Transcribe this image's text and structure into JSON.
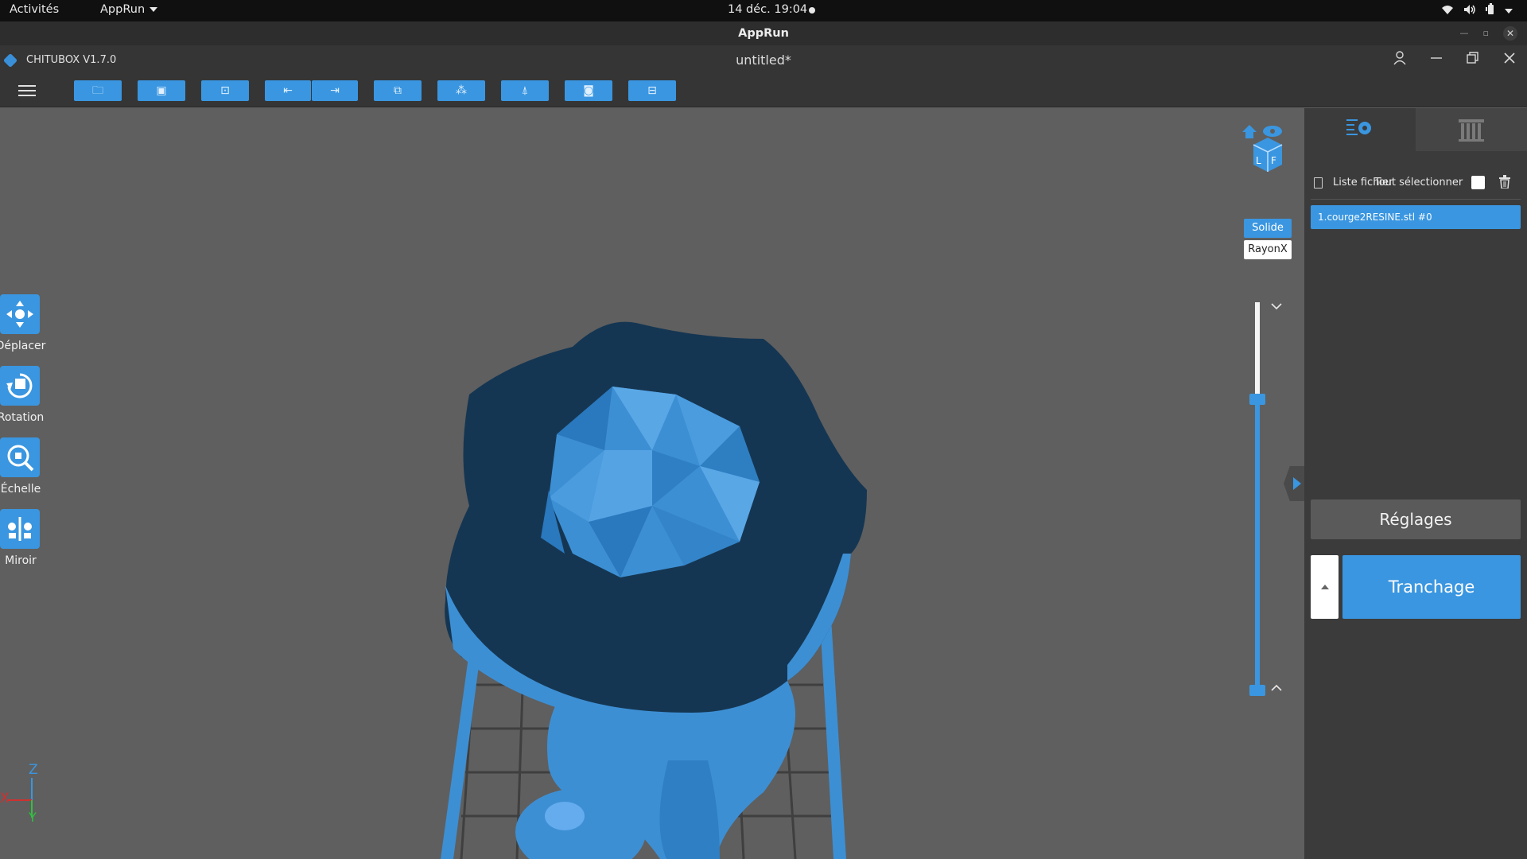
{
  "system_bar": {
    "activities": "Activités",
    "app_menu": "AppRun",
    "clock": "14 déc.  19:04"
  },
  "window": {
    "title": "AppRun"
  },
  "app": {
    "name": "CHITUBOX V1.7.0",
    "document_title": "untitled*"
  },
  "toolbar": {
    "items": [
      {
        "name": "open-file",
        "icon": "folder-icon"
      },
      {
        "name": "save-file",
        "icon": "save-icon"
      },
      {
        "name": "auto-layout",
        "icon": "layout-icon"
      },
      {
        "name": "undo",
        "icon": "undo-icon"
      },
      {
        "name": "redo",
        "icon": "redo-icon"
      },
      {
        "name": "copy",
        "icon": "copy-icon"
      },
      {
        "name": "hollow",
        "icon": "hollow-icon"
      },
      {
        "name": "supports",
        "icon": "support-icon"
      },
      {
        "name": "dig-hole",
        "icon": "hole-icon"
      },
      {
        "name": "repair",
        "icon": "repair-icon"
      }
    ]
  },
  "left_tools": [
    {
      "label": "Déplacer",
      "icon": "move-icon"
    },
    {
      "label": "Rotation",
      "icon": "rotate-icon"
    },
    {
      "label": "Échelle",
      "icon": "scale-icon"
    },
    {
      "label": "Miroir",
      "icon": "mirror-icon"
    }
  ],
  "view_modes": {
    "solid": "Solide",
    "xray": "RayonX",
    "active": "solid"
  },
  "layer_slider": {
    "top_fraction": 0.25,
    "bottom_fraction": 1.0
  },
  "right_panel": {
    "file_list_label": "Liste fichier",
    "select_all_label": "Tout sélectionner",
    "files": [
      "1.courge2RESINE.stl #0"
    ],
    "settings_button": "Réglages",
    "slice_button": "Tranchage"
  },
  "axes": {
    "x": "X",
    "y": "Y",
    "z": "Z"
  },
  "colors": {
    "accent": "#3a96e0",
    "model": "#3d8fd4",
    "model_dark": "#153652",
    "viewport_bg": "#5f5f5f",
    "panel_bg": "#3b3b3b"
  }
}
